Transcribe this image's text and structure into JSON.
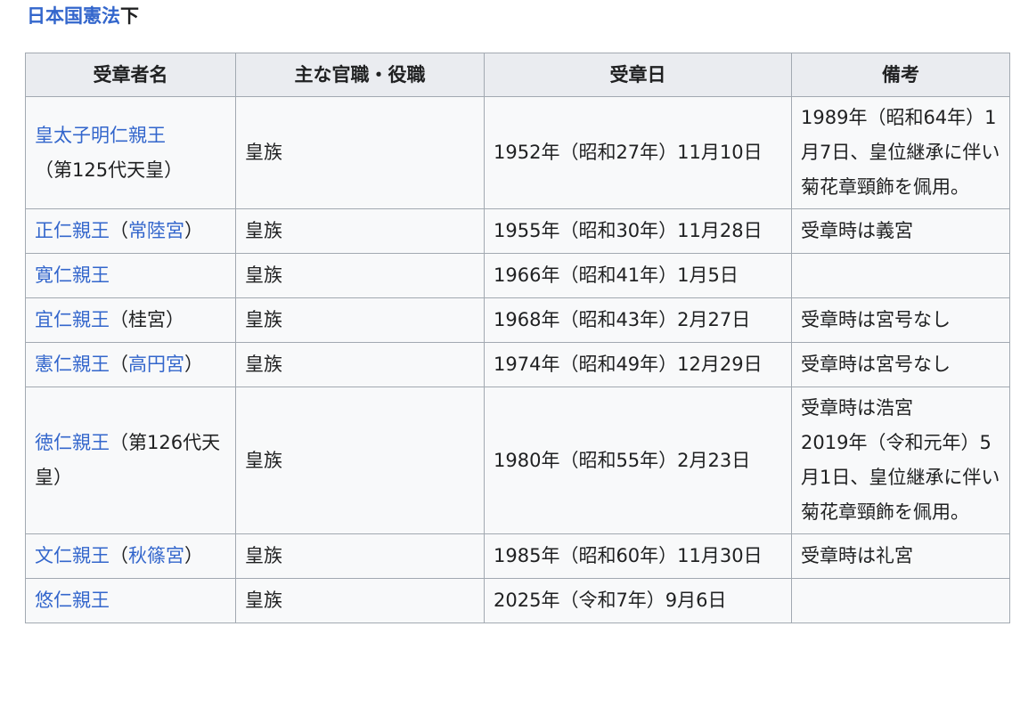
{
  "heading": {
    "link": "日本国憲法",
    "suffix": "下"
  },
  "table": {
    "headers": [
      "受章者名",
      "主な官職・役職",
      "受章日",
      "備考"
    ],
    "rows": [
      {
        "name_link": "皇太子明仁親王",
        "name_rest": "（第125代天皇）",
        "role": "皇族",
        "date": "1952年（昭和27年）11月10日",
        "note": "1989年（昭和64年）1月7日、皇位継承に伴い菊花章頸飾を佩用。"
      },
      {
        "name_link": "正仁親王",
        "name_mid": "（",
        "name_link2": "常陸宮",
        "name_rest": "）",
        "role": "皇族",
        "date": "1955年（昭和30年）11月28日",
        "note": "受章時は義宮"
      },
      {
        "name_link": "寛仁親王",
        "role": "皇族",
        "date": "1966年（昭和41年）1月5日",
        "note": ""
      },
      {
        "name_link": "宜仁親王",
        "name_rest": "（桂宮）",
        "role": "皇族",
        "date": "1968年（昭和43年）2月27日",
        "note": "受章時は宮号なし"
      },
      {
        "name_link": "憲仁親王",
        "name_mid": "（",
        "name_link2": "高円宮",
        "name_rest": "）",
        "role": "皇族",
        "date": "1974年（昭和49年）12月29日",
        "note": "受章時は宮号なし"
      },
      {
        "name_link": "徳仁親王",
        "name_rest": "（第126代天皇）",
        "role": "皇族",
        "date": "1980年（昭和55年）2月23日",
        "note": "受章時は浩宮",
        "note2": "2019年（令和元年）5月1日、皇位継承に伴い菊花章頸飾を佩用。"
      },
      {
        "name_link": "文仁親王",
        "name_mid": "（",
        "name_link2": "秋篠宮",
        "name_rest": "）",
        "role": "皇族",
        "date": "1985年（昭和60年）11月30日",
        "note": "受章時は礼宮"
      },
      {
        "name_link": "悠仁親王",
        "role": "皇族",
        "date": "2025年（令和7年）9月6日",
        "note": ""
      }
    ]
  }
}
